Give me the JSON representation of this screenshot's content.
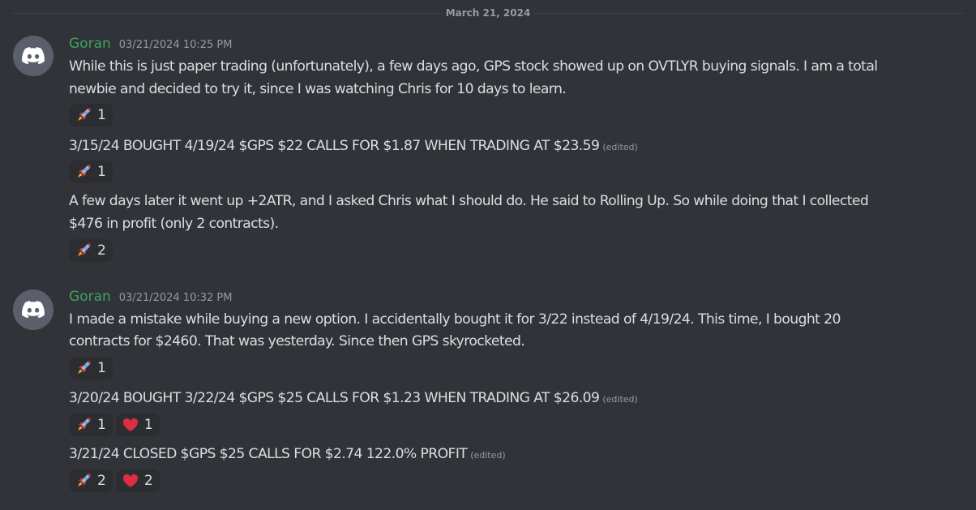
{
  "date_divider": "March 21, 2024",
  "messages": [
    {
      "username": "Goran",
      "timestamp": "03/21/2024 10:25 PM",
      "line1": "While this is just paper trading (unfortunately), a few days ago, GPS stock showed up on OVTLYR buying signals. I am a total",
      "line1b": "newbie and decided to try it, since I was watching Chris for 10 days to learn.",
      "reaction1": "1",
      "line2": "3/15/24 BOUGHT 4/19/24 $GPS $22 CALLS FOR $1.87 WHEN TRADING AT $23.59",
      "line2_edited": "(edited)",
      "reaction2": "1",
      "line3": "A few days later it went up +2ATR, and I asked Chris what I should do. He said to Rolling Up. So while doing that I collected",
      "line3b": "$476 in profit (only 2 contracts).",
      "reaction3": "2"
    },
    {
      "username": "Goran",
      "timestamp": "03/21/2024 10:32 PM",
      "line1": "I made a mistake while buying a new option. I accidentally bought it for 3/22 instead of 4/19/24. This time, I bought 20",
      "line1b": "contracts for $2460. That was yesterday. Since then GPS skyrocketed.",
      "reaction1": "1",
      "line2": "3/20/24 BOUGHT 3/22/24 $GPS $25 CALLS FOR $1.23 WHEN TRADING AT $26.09",
      "line2_edited": "(edited)",
      "reaction2_rocket": "1",
      "reaction2_heart": "1",
      "line3": "3/21/24 CLOSED $GPS $25 CALLS FOR $2.74 122.0% PROFIT",
      "line3_edited": "(edited)",
      "reaction3_rocket": "2",
      "reaction3_heart": "2"
    }
  ],
  "icons": {
    "avatar": "discord-logo-icon",
    "rocket": "rocket-emoji-icon",
    "heart": "heart-emoji-icon"
  },
  "colors": {
    "background": "#313338",
    "username": "#3ba55d",
    "text": "#dbdee1",
    "muted": "#949ba4",
    "reaction_bg": "#2b2d31",
    "heart": "#dd2e44"
  }
}
